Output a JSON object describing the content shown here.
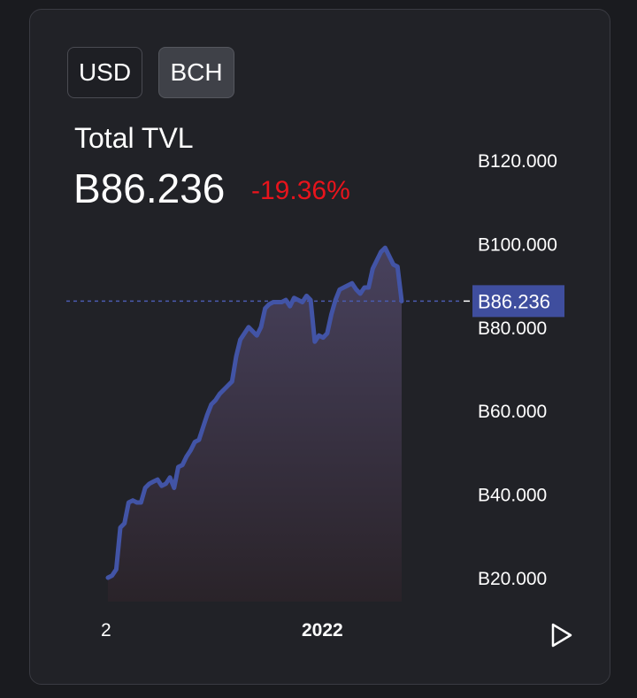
{
  "toggles": {
    "usd": "USD",
    "bch": "BCH"
  },
  "metric": {
    "label": "Total TVL",
    "value": "B86.236",
    "change": "-19.36%"
  },
  "colors": {
    "line": "#4254a6",
    "negative": "#e8141c",
    "badge": "#3f4e9e"
  },
  "icons": {
    "play": "play-icon"
  },
  "chart_data": {
    "type": "area",
    "x_tick_labels": [
      "2",
      "2022"
    ],
    "y_tick_labels": [
      "B20.000",
      "B40.000",
      "B60.000",
      "B80.000",
      "B100.000",
      "B120.000"
    ],
    "y_ticks": [
      20,
      40,
      60,
      80,
      100,
      120
    ],
    "ylim": [
      10,
      128
    ],
    "current_value": 86.236,
    "current_label": "B86.236",
    "grid": false,
    "series": [
      {
        "values": [
          20,
          20.5,
          22,
          32,
          33,
          38,
          38.5,
          38,
          38,
          41.5,
          42.5,
          43,
          43.5,
          42,
          42.5,
          44,
          41.5,
          46.5,
          47,
          49,
          50.5,
          52.5,
          53,
          56,
          59,
          61.5,
          62.5,
          64,
          65,
          66,
          67,
          73,
          77,
          78.5,
          80,
          79,
          78,
          80,
          84.5,
          85.5,
          86,
          86,
          86,
          86.5,
          85,
          87,
          86.5,
          86,
          87.5,
          86.5,
          76.5,
          78,
          77.5,
          78.5,
          83,
          86.5,
          89,
          89.5,
          90,
          90.5,
          89,
          88,
          89.5,
          89.5,
          94,
          96,
          98,
          99,
          97,
          95,
          94.5,
          86.236
        ]
      }
    ]
  }
}
